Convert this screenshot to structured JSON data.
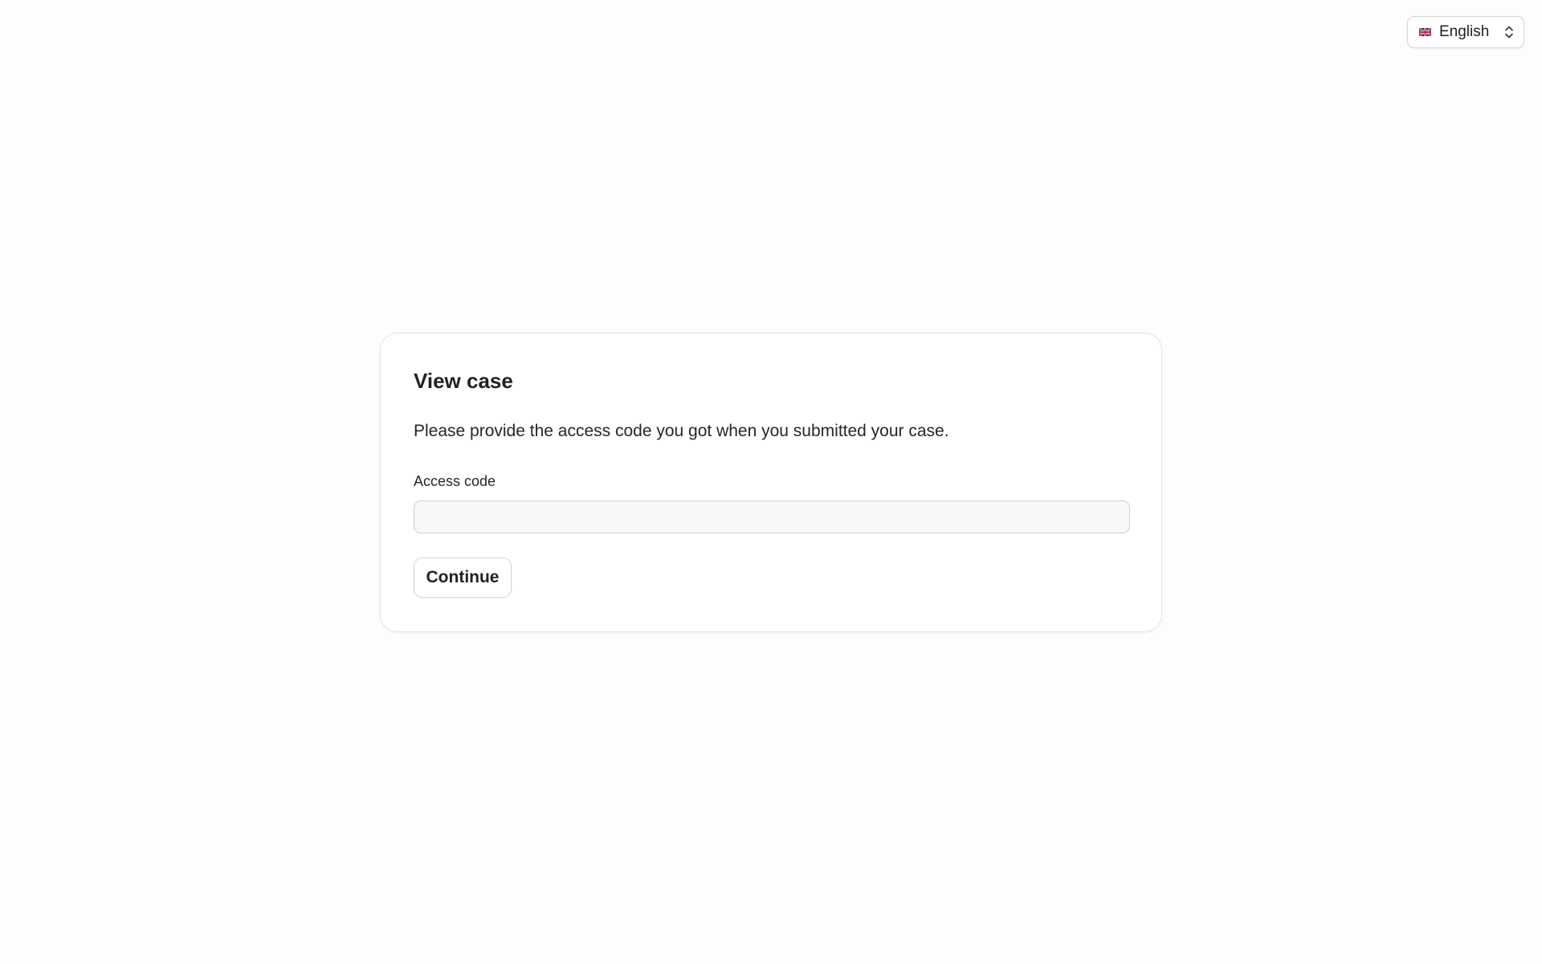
{
  "language_selector": {
    "label": "English",
    "flag_icon": "uk-flag-icon",
    "chevron_icon": "chevron-up-down-icon"
  },
  "card": {
    "title": "View case",
    "description": "Please provide the access code you got when you submitted your case.",
    "access_code": {
      "label": "Access code",
      "value": "",
      "placeholder": ""
    },
    "continue_label": "Continue"
  },
  "colors": {
    "background": "#fdfdfd",
    "card_background": "#ffffff",
    "border": "#e4e4e4",
    "text": "#1f1f1f",
    "input_background": "#f8f8f8"
  }
}
